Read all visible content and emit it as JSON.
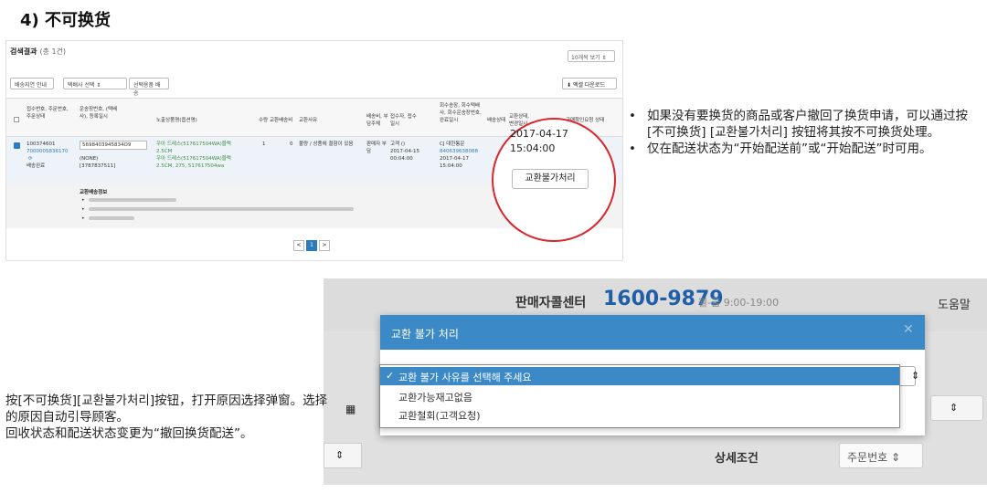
{
  "heading": "4) 不可换货",
  "screenshot1": {
    "title": "검색결과",
    "count": "(총 1건)",
    "page_size": "10개씩 보기",
    "bar_btn1": "배송지연 안내",
    "bar_select": "택배사 선택",
    "bar_btn2": "선택용품 배송",
    "excel_btn": "엑셀 다운로드",
    "columns": [
      "접수번호, 주문번호, 주문상태",
      "운송장번호, (택배사), 등록일시",
      "노출상품명(옵션명)",
      "수량",
      "교환배송비",
      "교환사유",
      "배송비, 부담주체",
      "접수자, 접수일시",
      "회수송장, 회수택배사, 회수운송장번호, 완료일시",
      "배송상태",
      "교환상태, 변경일시",
      "구매확인요청 상태"
    ],
    "row": {
      "order_no": "100374601",
      "order_sub": "7000005836170",
      "order_icon": "⟳",
      "order_status": "배송완료",
      "waybill": "5698403945834O9",
      "carrier": "(NONE)",
      "carrier_no": "[3787837511]",
      "product": "우아 드레스(517617504WA)블랙 2.5CM",
      "product2": "우아 드레스(517617504WA)블랙 2.5CM, 275, 517617504wa",
      "qty": "1",
      "fee": "0",
      "reason": "불량 / 상품에 결함이 있음",
      "payer": "판매자 부담",
      "receiver": "고객 ()",
      "recv_date": "2017-04-15",
      "recv_time": "00:04:00",
      "return_carrier": "CJ 대한통운",
      "return_no": "840639638088",
      "return_date": "2017-04-17",
      "return_time": "15:04:00"
    },
    "info_title": "교환배송정보",
    "pager_prev": "<",
    "pager_cur": "1",
    "pager_next": ">",
    "popup_date": "2017-04-17",
    "popup_time": "15:04:00",
    "popup_button": "교환불가처리"
  },
  "bullets": [
    "如果没有要换货的商品或客户撤回了换货申请，可以通过按[不可换货] [교환불가처리] 按钮将其按不可换货处理。",
    "仅在配送状态为“开始配送前”或“开始配送”时可用。"
  ],
  "screenshot2": {
    "center_label": "판매자콜센터",
    "phone": "1600-9879",
    "hours": "월-금 9:00-19:00",
    "help": "도움말",
    "detail_label": "상세조건",
    "order_select": "주문번호",
    "dialog_title": "교환 불가 처리",
    "options": [
      "교환 불가 사유를 선택해 주세요",
      "교환가능재고없음",
      "교환철회(고객요청)"
    ]
  },
  "left_text": {
    "line1": "按[不可换货][교환불가처리]按钮，打开原因选择弹窗。选择的原因自动引导顾客。",
    "line2": "回收状态和配送状态变更为“撤回换货配送”。"
  }
}
